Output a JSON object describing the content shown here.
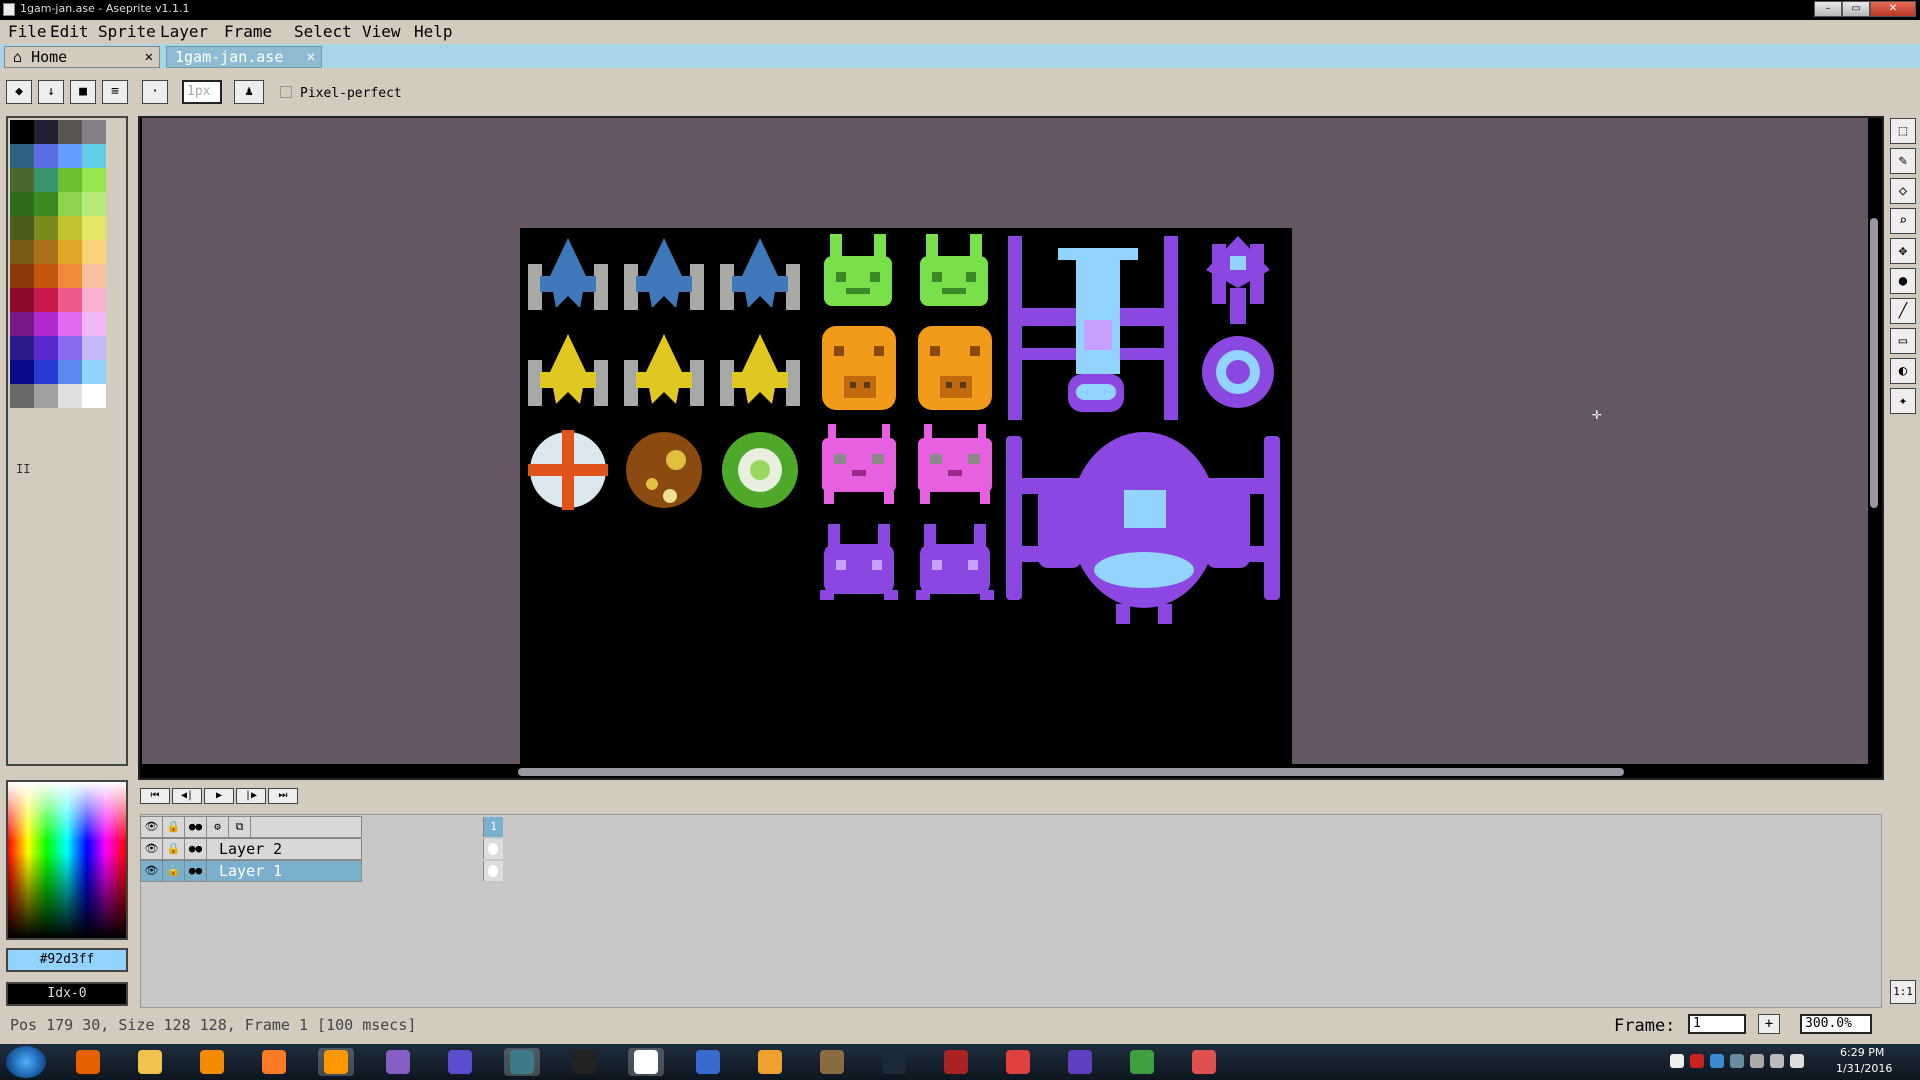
{
  "window": {
    "title": "1gam-jan.ase - Aseprite v1.1.1",
    "controls": [
      "–",
      "▭",
      "✕"
    ]
  },
  "menu": [
    "File",
    "Edit",
    "Sprite",
    "Layer",
    "Frame",
    "Select",
    "View",
    "Help"
  ],
  "tabs": [
    {
      "label": "Home",
      "icon": "home-icon",
      "close": "✕"
    },
    {
      "label": "1gam-jan.ase",
      "close": "✕",
      "active": true
    }
  ],
  "context_bar": {
    "brush_size": "1px",
    "pixel_perfect_label": "Pixel-perfect",
    "pixel_perfect_checked": false
  },
  "palette": {
    "handle": "II",
    "colors": [
      [
        "#000000",
        "#222034",
        "#595652",
        "#847e87"
      ],
      [
        "#306082",
        "#5b6ee1",
        "#639bff",
        "#5fcde4"
      ],
      [
        "#4b692f",
        "#37946e",
        "#6abe30",
        "#99e550"
      ],
      [
        "#2e6b1a",
        "#3e8a22",
        "#8fd24e",
        "#b7ea7a"
      ],
      [
        "#4b5f1c",
        "#7a8a1e",
        "#c2c22e",
        "#e4e66a"
      ],
      [
        "#7a5a14",
        "#a87318",
        "#e0a72a",
        "#f6d27a"
      ],
      [
        "#8a3a0a",
        "#c4560c",
        "#f08a3a",
        "#f8c0a0"
      ],
      [
        "#8a0a2a",
        "#c81a4a",
        "#f05a8a",
        "#f8b0d0"
      ],
      [
        "#7a1a8a",
        "#b02ad0",
        "#e06af0",
        "#f0b8f8"
      ],
      [
        "#2a1a8a",
        "#5a2ad0",
        "#8a6af0",
        "#c4b8f8"
      ],
      [
        "#0a0a8a",
        "#2a3ad0",
        "#5a8af0",
        "#92d3ff"
      ],
      [
        "#6a6a6a",
        "#a0a0a0",
        "#e0e0e0",
        "#ffffff"
      ]
    ]
  },
  "color_bar": {
    "foreground_hex": "#92d3ff",
    "foreground_label": "#92d3ff",
    "background_label": "Idx-0"
  },
  "tools": [
    "marquee-icon",
    "pencil-icon",
    "eraser-icon",
    "zoom-icon",
    "move-icon",
    "bucket-icon",
    "line-icon",
    "rectangle-icon",
    "contour-icon",
    "spray-icon"
  ],
  "tool_glyphs": [
    "⬚",
    "✎",
    "◇",
    "⌕",
    "✥",
    "●",
    "╱",
    "▭",
    "◐",
    "✦"
  ],
  "animation_controls": [
    "⏮",
    "◀|",
    "▶",
    "|▶",
    "⏭"
  ],
  "timeline": {
    "header_icons": [
      "👁",
      "🔒",
      "●●",
      "⚙",
      "⧉"
    ],
    "frame_number": "1",
    "layers": [
      {
        "name": "Layer 2",
        "active": false
      },
      {
        "name": "Layer 1",
        "active": true
      }
    ]
  },
  "zoom_reset_label": "1:1",
  "status": {
    "text": "Pos 179 30, Size 128 128, Frame 1 [100 msecs]",
    "frame_label": "Frame:",
    "frame_value": "1",
    "frame_add": "+",
    "zoom": "300.0%"
  },
  "taskbar": {
    "apps": [
      {
        "name": "firefox",
        "color": "#e66000"
      },
      {
        "name": "explorer",
        "color": "#f2c14e"
      },
      {
        "name": "vlc",
        "color": "#f18c00"
      },
      {
        "name": "xampp",
        "color": "#fb7a24"
      },
      {
        "name": "sublime",
        "color": "#ff9800",
        "active": true
      },
      {
        "name": "visual-studio",
        "color": "#865fc5"
      },
      {
        "name": "tiled",
        "color": "#5a4fcf"
      },
      {
        "name": "terminal-e",
        "color": "#3c7a8a",
        "active": true
      },
      {
        "name": "cmd",
        "color": "#222222"
      },
      {
        "name": "aseprite",
        "color": "#ffffff",
        "active": true
      },
      {
        "name": "paint",
        "color": "#3a6ad0"
      },
      {
        "name": "fl-studio",
        "color": "#f0a030"
      },
      {
        "name": "lmms",
        "color": "#8a6a40"
      },
      {
        "name": "steam",
        "color": "#1b2838"
      },
      {
        "name": "gun-tool",
        "color": "#aa2222"
      },
      {
        "name": "zsnes",
        "color": "#e04040"
      },
      {
        "name": "gamecube",
        "color": "#6040c0"
      },
      {
        "name": "game-maker",
        "color": "#40a040"
      },
      {
        "name": "balloons",
        "color": "#e05050"
      }
    ],
    "time": "6:29 PM",
    "date": "1/31/2016"
  }
}
